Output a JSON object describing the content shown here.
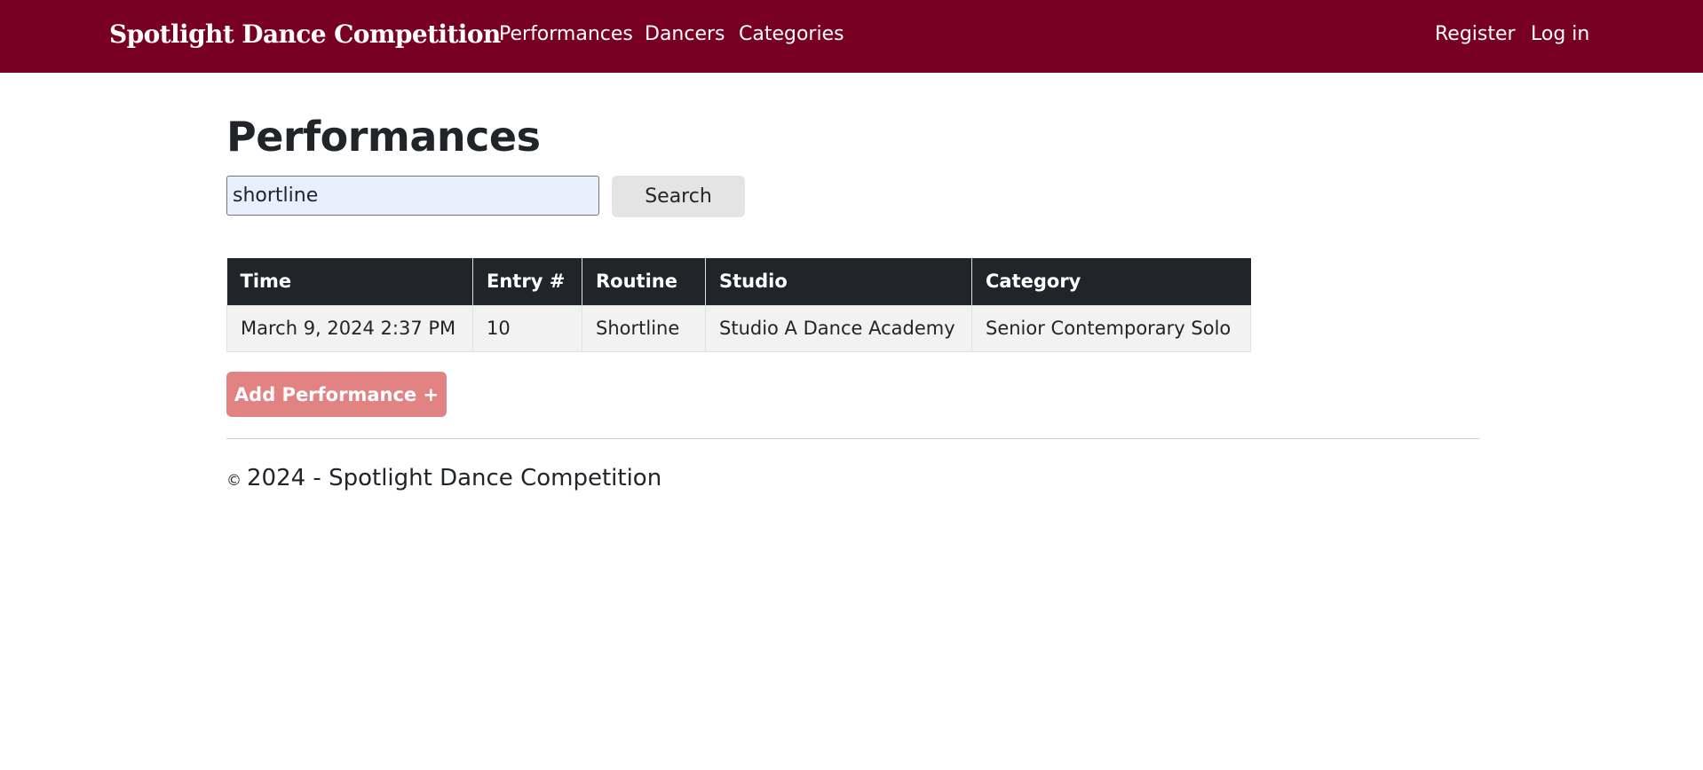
{
  "navbar": {
    "brand": "Spotlight Dance Competition",
    "links": [
      {
        "label": "Performances"
      },
      {
        "label": "Dancers"
      },
      {
        "label": "Categories"
      }
    ],
    "auth": [
      {
        "label": "Register"
      },
      {
        "label": "Log in"
      }
    ],
    "background_color": "#780022"
  },
  "main": {
    "title": "Performances",
    "search": {
      "value": "shortline",
      "button_label": "Search"
    },
    "table": {
      "columns": [
        "Time",
        "Entry #",
        "Routine",
        "Studio",
        "Category"
      ],
      "rows": [
        {
          "time": "March 9, 2024 2:37 PM",
          "entry": "10",
          "routine": "Shortline",
          "studio": "Studio A Dance Academy",
          "category": "Senior Contemporary Solo"
        }
      ]
    },
    "add_button_label": "Add Performance +"
  },
  "footer": {
    "copyright_symbol": "©",
    "text": "2024 - Spotlight Dance Competition"
  },
  "colors": {
    "accent": "#780022",
    "add_button": "#e18383",
    "table_header": "#212529"
  }
}
